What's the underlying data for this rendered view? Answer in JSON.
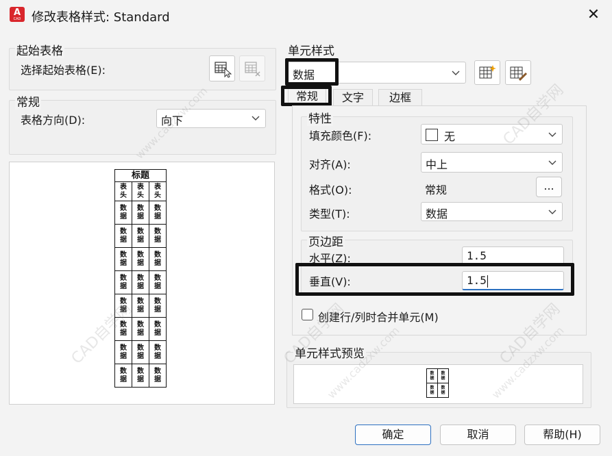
{
  "window": {
    "title": "修改表格样式: Standard",
    "app_icon_letter": "A",
    "app_icon_sub": "CAD",
    "close_glyph": "✕"
  },
  "starting_table": {
    "group_label": "起始表格",
    "select_label": "选择起始表格(E):"
  },
  "general": {
    "group_label": "常规",
    "direction_label": "表格方向(D):",
    "direction_value": "向下"
  },
  "table_preview": {
    "title": "标题",
    "header": [
      "表\n头",
      "表\n头",
      "表\n头"
    ],
    "rows": [
      [
        "数\n据",
        "数\n据",
        "数\n据"
      ],
      [
        "数\n据",
        "数\n据",
        "数\n据"
      ],
      [
        "数\n据",
        "数\n据",
        "数\n据"
      ],
      [
        "数\n据",
        "数\n据",
        "数\n据"
      ],
      [
        "数\n据",
        "数\n据",
        "数\n据"
      ],
      [
        "数\n据",
        "数\n据",
        "数\n据"
      ],
      [
        "数\n据",
        "数\n据",
        "数\n据"
      ],
      [
        "数\n据",
        "数\n据",
        "数\n据"
      ]
    ]
  },
  "cell_style": {
    "group_label": "单元样式",
    "selected": "数据"
  },
  "tabs": [
    {
      "label": "常规",
      "active": true
    },
    {
      "label": "文字",
      "active": false
    },
    {
      "label": "边框",
      "active": false
    }
  ],
  "properties": {
    "group_label": "特性",
    "fill_label": "填充颜色(F):",
    "fill_value": "无",
    "align_label": "对齐(A):",
    "align_value": "中上",
    "format_label": "格式(O):",
    "format_value": "常规",
    "format_button": "...",
    "type_label": "类型(T):",
    "type_value": "数据"
  },
  "margins": {
    "group_label": "页边距",
    "horizontal_label": "水平(Z):",
    "horizontal_value": "1.5",
    "vertical_label": "垂直(V):",
    "vertical_value": "1.5"
  },
  "merge_checkbox": {
    "label": "创建行/列时合并单元(M)",
    "checked": false
  },
  "cell_preview": {
    "group_label": "单元样式预览",
    "cells": [
      "数\n据",
      "数\n据",
      "数\n据",
      "数\n据"
    ]
  },
  "buttons": {
    "ok": "确定",
    "cancel": "取消",
    "help": "帮助(H)"
  },
  "watermark": {
    "text": "CAD自学网",
    "url": "www.cadzxw.com"
  },
  "colors": {
    "accent": "#2b6fc0",
    "app_icon": "#d9262c",
    "highlight_box": "#111111"
  }
}
